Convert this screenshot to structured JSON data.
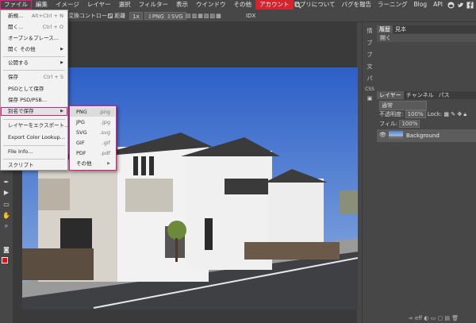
{
  "menubar": {
    "items": [
      "ファイル",
      "編集",
      "イメージ",
      "レイヤー",
      "選択",
      "フィルター",
      "表示",
      "ウインドウ",
      "その他",
      "アカウント"
    ],
    "right": [
      "アプリについて",
      "バグを報告",
      "ラーニング",
      "Blog",
      "API"
    ]
  },
  "optbar": {
    "transform_label": "変換コントロール",
    "distance_label": "距離",
    "zoom": "1x",
    "png": "PNG",
    "svg": "SVG",
    "idx": "IDX"
  },
  "file_menu": {
    "items": [
      {
        "label": "新規...",
        "shortcut": "Alt+Ctrl + N"
      },
      {
        "label": "開く...",
        "shortcut": "Ctrl + O"
      },
      {
        "label": "オープン＆プレース..."
      },
      {
        "label": "開く その他"
      },
      {
        "label": "公開する"
      },
      {
        "label": "保存",
        "shortcut": "Ctrl + S"
      },
      {
        "label": "PSDとして保存"
      },
      {
        "label": "保存 PSD/PSB..."
      },
      {
        "label": "別名で保存"
      },
      {
        "label": "レイヤーをエクスポート..."
      },
      {
        "label": "Export Color Lookup..."
      },
      {
        "label": "File Info..."
      },
      {
        "label": "スクリプト"
      }
    ]
  },
  "save_as_submenu": {
    "items": [
      {
        "label": "PNG",
        "ext": ".png"
      },
      {
        "label": "JPG",
        "ext": ".jpg"
      },
      {
        "label": "SVG",
        "ext": ".svg"
      },
      {
        "label": "GIF",
        "ext": ".gif"
      },
      {
        "label": "PDF",
        "ext": ".pdf"
      },
      {
        "label": "その他"
      }
    ]
  },
  "side_icons": [
    "情",
    "ブ",
    "ブ",
    "文",
    "パ",
    "CSS"
  ],
  "history_panel": {
    "tabs": [
      "履歴",
      "見本"
    ],
    "entry": "開く"
  },
  "layers_panel": {
    "tabs": [
      "レイヤー",
      "チャンネル",
      "パス"
    ],
    "blend_mode": "通常",
    "opacity_label": "不透明度:",
    "opacity_value": "100%",
    "lock_label": "Lock:",
    "fill_label": "フィル:",
    "fill_value": "100%",
    "layer_name": "Background"
  },
  "colors": {
    "accent": "#e8177d",
    "account_bg": "#d4252f",
    "foreground": "#ff0000",
    "background": "#000000"
  }
}
